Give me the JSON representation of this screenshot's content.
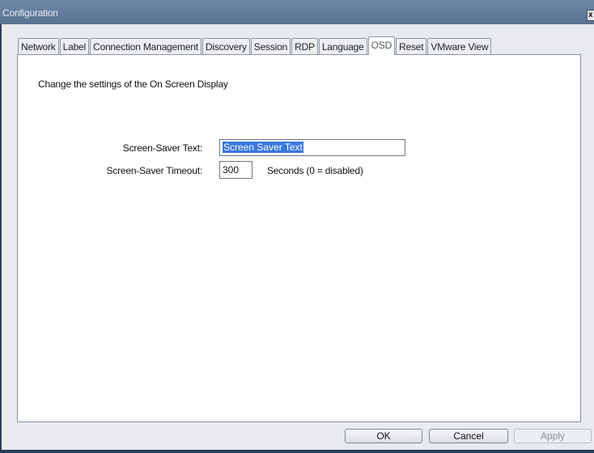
{
  "window": {
    "title": "Configuration",
    "close_glyph": "x"
  },
  "tabs": [
    {
      "label": "Network"
    },
    {
      "label": "Label"
    },
    {
      "label": "Connection Management"
    },
    {
      "label": "Discovery"
    },
    {
      "label": "Session"
    },
    {
      "label": "RDP"
    },
    {
      "label": "Language"
    },
    {
      "label": "OSD",
      "active": true
    },
    {
      "label": "Reset"
    },
    {
      "label": "VMware View"
    }
  ],
  "osd": {
    "description": "Change the settings of the On Screen Display",
    "screensaver_text_label": "Screen-Saver Text:",
    "screensaver_text_value": "Screen Saver Text",
    "screensaver_timeout_label": "Screen-Saver Timeout:",
    "screensaver_timeout_value": "300",
    "timeout_unit": "Seconds (0 = disabled)"
  },
  "buttons": {
    "ok": "OK",
    "cancel": "Cancel",
    "apply": "Apply"
  },
  "colors": {
    "titlebar": "#6a81a1",
    "selection": "#3a78e0"
  }
}
